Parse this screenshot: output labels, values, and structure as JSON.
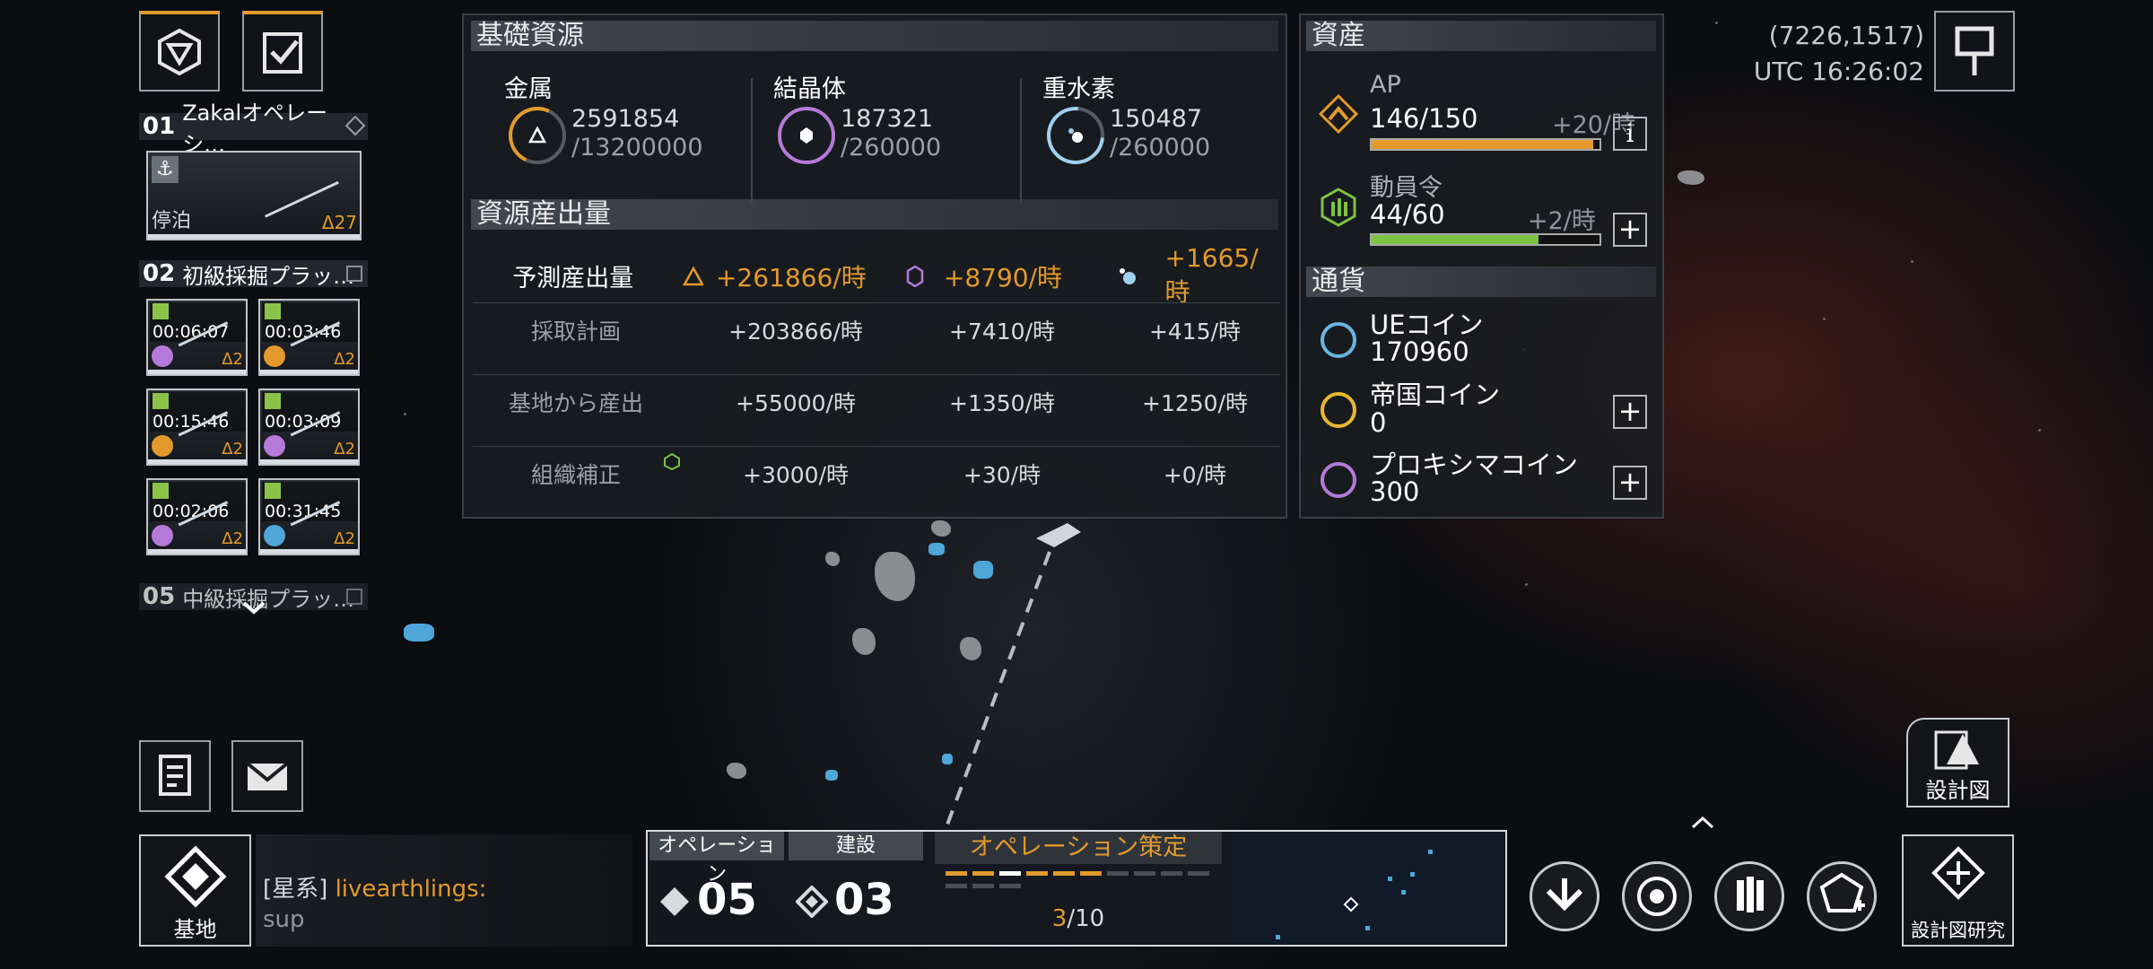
{
  "fleets": {
    "group1": {
      "num": "01",
      "name": "Zakalオペレーシ…",
      "status": "停泊",
      "delta": "Δ27"
    },
    "group2": {
      "num": "02",
      "name": "初級採掘プラッ…"
    },
    "cards": [
      {
        "timer": "00:06:07",
        "delta": "Δ2",
        "pie_color": "#b57ad9"
      },
      {
        "timer": "00:03:46",
        "delta": "Δ2",
        "pie_color": "#e39a2c"
      },
      {
        "timer": "00:15:46",
        "delta": "Δ2",
        "pie_color": "#e39a2c"
      },
      {
        "timer": "00:03:09",
        "delta": "Δ2",
        "pie_color": "#b57ad9"
      },
      {
        "timer": "00:02:06",
        "delta": "Δ2",
        "pie_color": "#b57ad9"
      },
      {
        "timer": "00:31:45",
        "delta": "Δ2",
        "pie_color": "#4ea6d9"
      }
    ],
    "group5": {
      "num": "05",
      "name": "中級採掘プラッ…"
    }
  },
  "basic_resources": {
    "title": "基礎資源",
    "items": [
      {
        "name": "金属",
        "current": "2591854",
        "cap": "/13200000",
        "color": "#e39a2c"
      },
      {
        "name": "結晶体",
        "current": "187321",
        "cap": "/260000",
        "color": "#b57ad9"
      },
      {
        "name": "重水素",
        "current": "150487",
        "cap": "/260000",
        "color": "#9fd0ee"
      }
    ]
  },
  "production": {
    "title": "資源産出量",
    "forecast_label": "予測産出量",
    "forecast": [
      "+261866/時",
      "+8790/時",
      "+1665/時"
    ],
    "rows": [
      {
        "label": "採取計画",
        "values": [
          "+203866/時",
          "+7410/時",
          "+415/時"
        ]
      },
      {
        "label": "基地から産出",
        "values": [
          "+55000/時",
          "+1350/時",
          "+1250/時"
        ]
      },
      {
        "label": "組織補正",
        "values": [
          "+3000/時",
          "+30/時",
          "+0/時"
        ]
      }
    ]
  },
  "assets": {
    "title": "資産",
    "ap": {
      "name": "AP",
      "value": "146/150",
      "rate": "+20/時",
      "fill": 0.973,
      "info": "i"
    },
    "mobilize": {
      "name": "動員令",
      "value": "44/60",
      "rate": "+2/時",
      "fill": 0.733
    },
    "currency_title": "通貨",
    "currencies": [
      {
        "name": "UEコイン",
        "value": "170960",
        "color": "#6ab4e0"
      },
      {
        "name": "帝国コイン",
        "value": "0",
        "color": "#e8b830"
      },
      {
        "name": "プロキシマコイン",
        "value": "300",
        "color": "#b57ad9"
      }
    ]
  },
  "top_right": {
    "coords": "(7226,1517)",
    "time": "UTC 16:26:02"
  },
  "bottom": {
    "base_label": "基地",
    "chat_channel": "[星系]",
    "chat_user": "livearthlings:",
    "chat_message": "sup",
    "tab_operation": "オペレーション",
    "tab_build": "建設",
    "op_count": "05",
    "build_count": "03",
    "strategy_title": "オペレーション策定",
    "strategy_current": "3",
    "strategy_total": "/10",
    "blueprint_label": "設計図",
    "blueprint_research_label": "設計図研究"
  },
  "colors": {
    "accent": "#e39a2c",
    "green": "#7dc242",
    "panel": "#1a1d21"
  }
}
